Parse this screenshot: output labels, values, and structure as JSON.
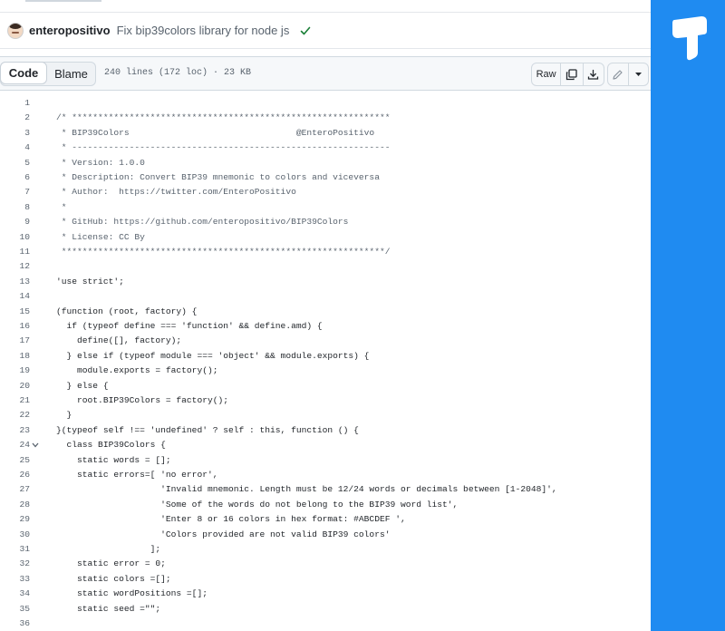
{
  "commit": {
    "author": "enteropositivo",
    "message": "Fix bip39colors library for node js"
  },
  "file_header": {
    "code_label": "Code",
    "blame_label": "Blame",
    "meta": "240 lines (172 loc) · 23 KB",
    "raw_label": "Raw"
  },
  "code": {
    "fold_line": "24",
    "lines": [
      {
        "n": "1",
        "t": ""
      },
      {
        "n": "2",
        "t": "/* *************************************************************",
        "c": "comment"
      },
      {
        "n": "3",
        "t": " * BIP39Colors                                @EnteroPositivo",
        "c": "comment"
      },
      {
        "n": "4",
        "t": " * -------------------------------------------------------------",
        "c": "comment"
      },
      {
        "n": "5",
        "t": " * Version: 1.0.0",
        "c": "comment"
      },
      {
        "n": "6",
        "t": " * Description: Convert BIP39 mnemonic to colors and viceversa",
        "c": "comment"
      },
      {
        "n": "7",
        "t": " * Author:  https://twitter.com/EnteroPositivo",
        "c": "comment"
      },
      {
        "n": "8",
        "t": " *",
        "c": "comment"
      },
      {
        "n": "9",
        "t": " * GitHub: https://github.com/enteropositivo/BIP39Colors",
        "c": "comment"
      },
      {
        "n": "10",
        "t": " * License: CC By",
        "c": "comment"
      },
      {
        "n": "11",
        "t": " **************************************************************/",
        "c": "comment"
      },
      {
        "n": "12",
        "t": ""
      },
      {
        "n": "13",
        "t": "'use strict';"
      },
      {
        "n": "14",
        "t": ""
      },
      {
        "n": "15",
        "t": "(function (root, factory) {"
      },
      {
        "n": "16",
        "t": "  if (typeof define === 'function' && define.amd) {"
      },
      {
        "n": "17",
        "t": "    define([], factory);"
      },
      {
        "n": "18",
        "t": "  } else if (typeof module === 'object' && module.exports) {"
      },
      {
        "n": "19",
        "t": "    module.exports = factory();"
      },
      {
        "n": "20",
        "t": "  } else {"
      },
      {
        "n": "21",
        "t": "    root.BIP39Colors = factory();"
      },
      {
        "n": "22",
        "t": "  }"
      },
      {
        "n": "23",
        "t": "}(typeof self !== 'undefined' ? self : this, function () {"
      },
      {
        "n": "24",
        "t": "  class BIP39Colors {"
      },
      {
        "n": "25",
        "t": "    static words = [];"
      },
      {
        "n": "26",
        "t": "    static errors=[ 'no error',"
      },
      {
        "n": "27",
        "t": "                    'Invalid mnemonic. Length must be 12/24 words or decimals between [1-2048]',"
      },
      {
        "n": "28",
        "t": "                    'Some of the words do not belong to the BIP39 word list',"
      },
      {
        "n": "29",
        "t": "                    'Enter 8 or 16 colors in hex format: #ABCDEF ',"
      },
      {
        "n": "30",
        "t": "                    'Colors provided are not valid BIP39 colors'"
      },
      {
        "n": "31",
        "t": "                  ];"
      },
      {
        "n": "32",
        "t": "    static error = 0;"
      },
      {
        "n": "33",
        "t": "    static colors =[];"
      },
      {
        "n": "34",
        "t": "    static wordPositions =[];"
      },
      {
        "n": "35",
        "t": "    static seed =\"\";"
      },
      {
        "n": "36",
        "t": ""
      }
    ]
  }
}
